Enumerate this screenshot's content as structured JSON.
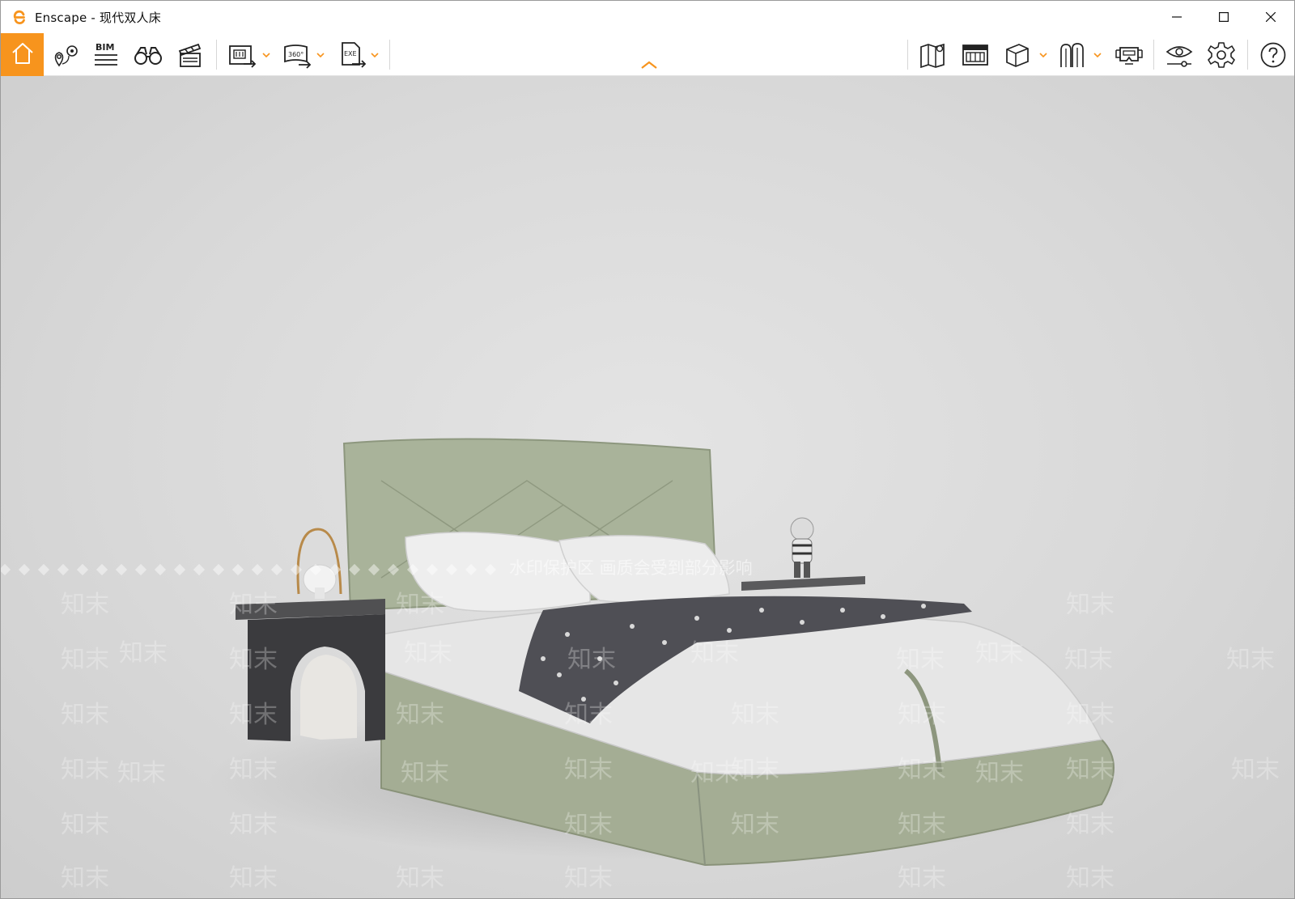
{
  "window": {
    "title": "Enscape - 现代双人床",
    "controls": [
      "minimize",
      "maximize",
      "close"
    ]
  },
  "toolbar": {
    "collapse_icon": "chevron-up-icon",
    "accent_color": "#f7941d",
    "bim_label": "BIM",
    "panorama_label": "360°",
    "exe_label": "EXE",
    "left_buttons": [
      {
        "name": "home",
        "icon": "home-icon",
        "active": true
      },
      {
        "name": "views",
        "icon": "location-pin-icon"
      },
      {
        "name": "bim",
        "icon": "bim-icon"
      },
      {
        "name": "walk-mode",
        "icon": "binoculars-icon"
      },
      {
        "name": "video-editor",
        "icon": "clapperboard-icon"
      },
      {
        "name": "batch-render",
        "icon": "batch-render-icon"
      },
      {
        "name": "panorama",
        "icon": "panorama-360-icon"
      },
      {
        "name": "export-exe",
        "icon": "export-exe-icon"
      }
    ],
    "right_buttons": [
      {
        "name": "map",
        "icon": "map-icon"
      },
      {
        "name": "asset-library",
        "icon": "asset-library-icon"
      },
      {
        "name": "material-editor",
        "icon": "cube-icon"
      },
      {
        "name": "sections",
        "icon": "sections-icon"
      },
      {
        "name": "vr-headset",
        "icon": "vr-headset-icon"
      },
      {
        "name": "visual-settings",
        "icon": "eye-slider-icon"
      },
      {
        "name": "general-settings",
        "icon": "gear-icon"
      },
      {
        "name": "help",
        "icon": "help-icon"
      }
    ]
  },
  "viewport": {
    "watermark_text": "知末",
    "watermark_notice": "水印保护区  画质会受到部分影响"
  }
}
